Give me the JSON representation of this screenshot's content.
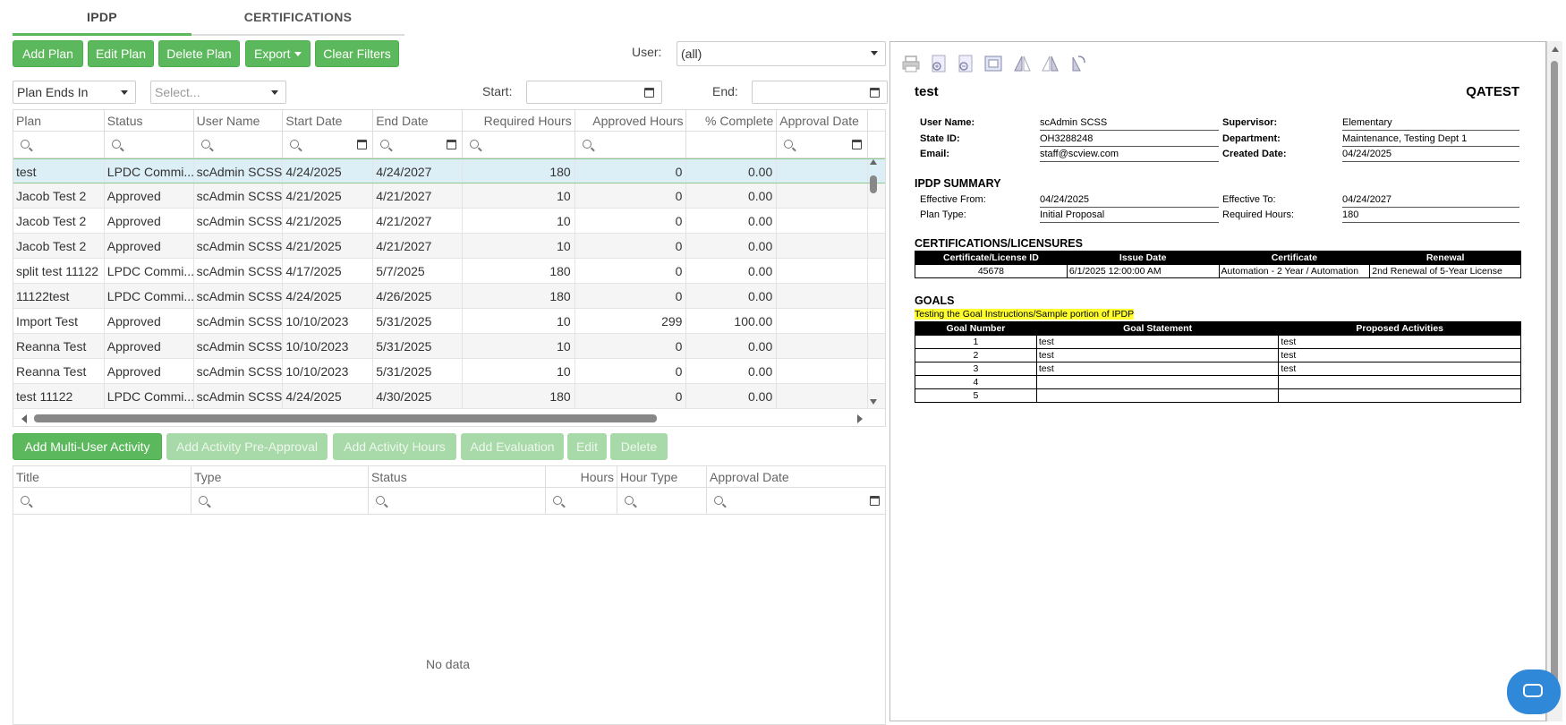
{
  "tabs": [
    {
      "label": "IPDP",
      "active": true
    },
    {
      "label": "CERTIFICATIONS",
      "active": false
    }
  ],
  "toolbar": {
    "add_plan": "Add Plan",
    "edit_plan": "Edit Plan",
    "delete_plan": "Delete Plan",
    "export": "Export",
    "clear_filters": "Clear Filters"
  },
  "user_filter": {
    "label": "User:",
    "value": "(all)"
  },
  "plan_ends_filter": {
    "value": "Plan Ends In"
  },
  "select_filter": {
    "placeholder": "Select..."
  },
  "start_filter": {
    "label": "Start:"
  },
  "end_filter": {
    "label": "End:"
  },
  "plans_grid": {
    "columns": [
      "Plan",
      "Status",
      "User Name",
      "Start Date",
      "End Date",
      "Required Hours",
      "Approved Hours",
      "% Complete",
      "Approval Date"
    ],
    "rows": [
      [
        "test",
        "LPDC Commi...",
        "scAdmin SCSS",
        "4/24/2025",
        "4/24/2027",
        "180",
        "0",
        "0.00",
        ""
      ],
      [
        "Jacob Test 2",
        "Approved",
        "scAdmin SCSS",
        "4/21/2025",
        "4/21/2027",
        "10",
        "0",
        "0.00",
        ""
      ],
      [
        "Jacob Test 2",
        "Approved",
        "scAdmin SCSS",
        "4/21/2025",
        "4/21/2027",
        "10",
        "0",
        "0.00",
        ""
      ],
      [
        "Jacob Test 2",
        "Approved",
        "scAdmin SCSS",
        "4/21/2025",
        "4/21/2027",
        "10",
        "0",
        "0.00",
        ""
      ],
      [
        "split test 11122",
        "LPDC Commi...",
        "scAdmin SCSS",
        "4/17/2025",
        "5/7/2025",
        "180",
        "0",
        "0.00",
        ""
      ],
      [
        "11122test",
        "LPDC Commi...",
        "scAdmin SCSS",
        "4/24/2025",
        "4/26/2025",
        "180",
        "0",
        "0.00",
        ""
      ],
      [
        "Import Test",
        "Approved",
        "scAdmin SCSS",
        "10/10/2023",
        "5/31/2025",
        "10",
        "299",
        "100.00",
        ""
      ],
      [
        "Reanna Test",
        "Approved",
        "scAdmin SCSS",
        "10/10/2023",
        "5/31/2025",
        "10",
        "0",
        "0.00",
        ""
      ],
      [
        "Reanna Test",
        "Approved",
        "scAdmin SCSS",
        "10/10/2023",
        "5/31/2025",
        "10",
        "0",
        "0.00",
        ""
      ],
      [
        "test 11122",
        "LPDC Commi...",
        "scAdmin SCSS",
        "4/24/2025",
        "4/30/2025",
        "180",
        "0",
        "0.00",
        ""
      ]
    ]
  },
  "activity_toolbar": {
    "add_multi": "Add Multi-User Activity",
    "add_preapproval": "Add Activity Pre-Approval",
    "add_hours": "Add Activity Hours",
    "add_eval": "Add Evaluation",
    "edit": "Edit",
    "delete": "Delete"
  },
  "activity_grid": {
    "columns": [
      "Title",
      "Type",
      "Status",
      "Hours",
      "Hour Type",
      "Approval Date"
    ],
    "empty_text": "No data"
  },
  "report": {
    "title": "test",
    "org": "QATEST",
    "user_name_label": "User Name:",
    "user_name": "scAdmin SCSS",
    "state_id_label": "State ID:",
    "state_id": "OH3288248",
    "email_label": "Email:",
    "email": "staff@scview.com",
    "supervisor_label": "Supervisor:",
    "supervisor": "Elementary",
    "department_label": "Department:",
    "department": "Maintenance, Testing Dept 1",
    "created_label": "Created Date:",
    "created": "04/24/2025",
    "summary_heading": "IPDP SUMMARY",
    "eff_from_label": "Effective From:",
    "eff_from": "04/24/2025",
    "eff_to_label": "Effective To:",
    "eff_to": "04/24/2027",
    "plan_type_label": "Plan Type:",
    "plan_type": "Initial Proposal",
    "req_hours_label": "Required Hours:",
    "req_hours": "180",
    "cert_heading": "CERTIFICATIONS/LICENSURES",
    "cert_columns": [
      "Certificate/License ID",
      "Issue Date",
      "Certificate",
      "Renewal"
    ],
    "cert_rows": [
      [
        "45678",
        "6/1/2025 12:00:00 AM",
        "Automation - 2 Year / Automation",
        "2nd Renewal of 5-Year License"
      ]
    ],
    "goals_heading": "GOALS",
    "goals_note": "Testing the Goal Instructions/Sample portion of IPDP",
    "goal_columns": [
      "Goal Number",
      "Goal Statement",
      "Proposed Activities"
    ],
    "goal_rows": [
      [
        "1",
        "test",
        "test"
      ],
      [
        "2",
        "test",
        "test"
      ],
      [
        "3",
        "test",
        "test"
      ],
      [
        "4",
        "",
        ""
      ],
      [
        "5",
        "",
        ""
      ]
    ]
  },
  "colors": {
    "accent": "#5cb85c",
    "selected_row": "#dceef6",
    "chat": "#2f88d8",
    "highlight": "#ffff2e"
  }
}
